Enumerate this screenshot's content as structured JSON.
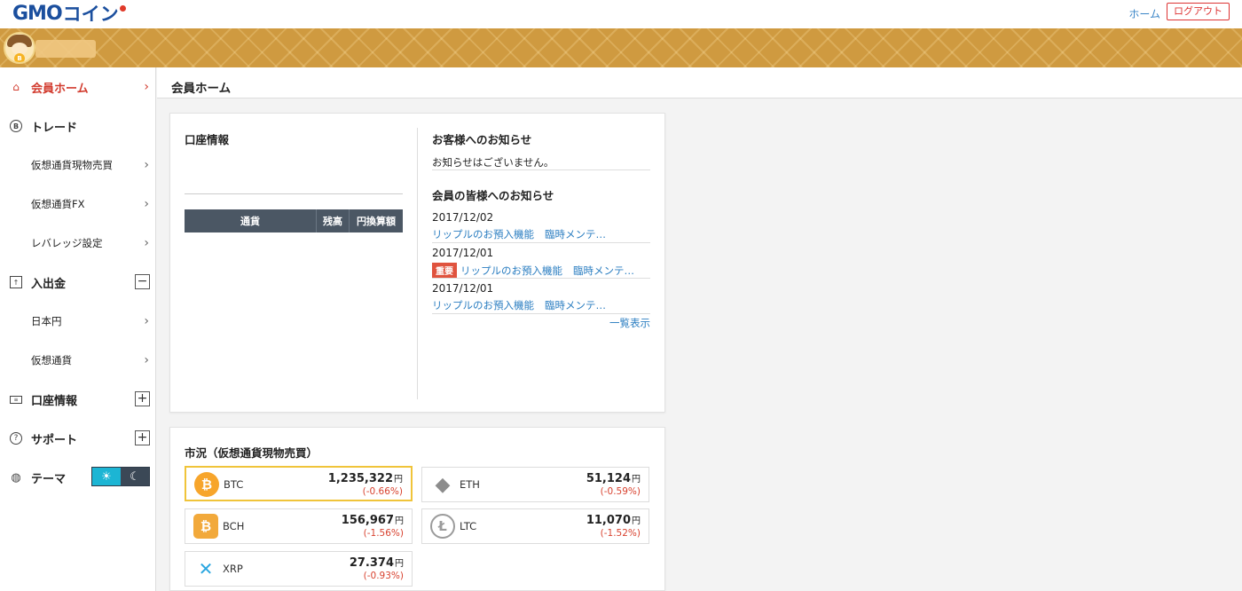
{
  "header": {
    "logo_gmo": "GMO",
    "logo_coin": "コイン",
    "home_link": "ホーム",
    "logout_label": "ログアウト"
  },
  "sidebar": {
    "items": [
      {
        "label": "会員ホーム",
        "icon": "home-icon"
      },
      {
        "label": "トレード",
        "icon": "bitcoin-icon"
      },
      {
        "label": "仮想通貨現物売買"
      },
      {
        "label": "仮想通貨FX"
      },
      {
        "label": "レバレッジ設定"
      },
      {
        "label": "入出金",
        "icon": "deposit-icon"
      },
      {
        "label": "日本円"
      },
      {
        "label": "仮想通貨"
      },
      {
        "label": "口座情報",
        "icon": "account-icon"
      },
      {
        "label": "サポート",
        "icon": "help-icon"
      },
      {
        "label": "テーマ",
        "icon": "palette-icon"
      }
    ],
    "minus": "−",
    "plus": "+"
  },
  "page": {
    "title": "会員ホーム"
  },
  "account": {
    "title": "口座情報",
    "table_headers": [
      "通貨",
      "残高",
      "円換算額"
    ]
  },
  "notices": {
    "customer_title": "お客様へのお知らせ",
    "customer_empty": "お知らせはございません。",
    "members_title": "会員の皆様へのお知らせ",
    "items": [
      {
        "date": "2017/12/02",
        "tag": "",
        "link1": "リップルのお預入機能",
        "link2": "臨時メンテ…"
      },
      {
        "date": "2017/12/01",
        "tag": "重要",
        "link1": "リップルのお預入機能",
        "link2": "臨時メンテ…"
      },
      {
        "date": "2017/12/01",
        "tag": "",
        "link1": "リップルのお預入機能",
        "link2": "臨時メンテ…"
      }
    ],
    "list_all": "一覧表示"
  },
  "market": {
    "title": "市況（仮想通貨現物売買）",
    "yen": "円",
    "tiles": [
      {
        "symbol": "BTC",
        "price": "1,235,322",
        "change": "(-0.66%)",
        "color": "#f7a52b",
        "glyph": "₿"
      },
      {
        "symbol": "ETH",
        "price": "51,124",
        "change": "(-0.59%)",
        "color": "#8c8c8c",
        "glyph": "◆"
      },
      {
        "symbol": "BCH",
        "price": "156,967",
        "change": "(-1.56%)",
        "color": "#f2a93b",
        "glyph": "₿"
      },
      {
        "symbol": "LTC",
        "price": "11,070",
        "change": "(-1.52%)",
        "color": "#9b9b9b",
        "glyph": "Ł"
      },
      {
        "symbol": "XRP",
        "price": "27.374",
        "change": "(-0.93%)",
        "color": "#2aa6e0",
        "glyph": "✕"
      }
    ]
  }
}
